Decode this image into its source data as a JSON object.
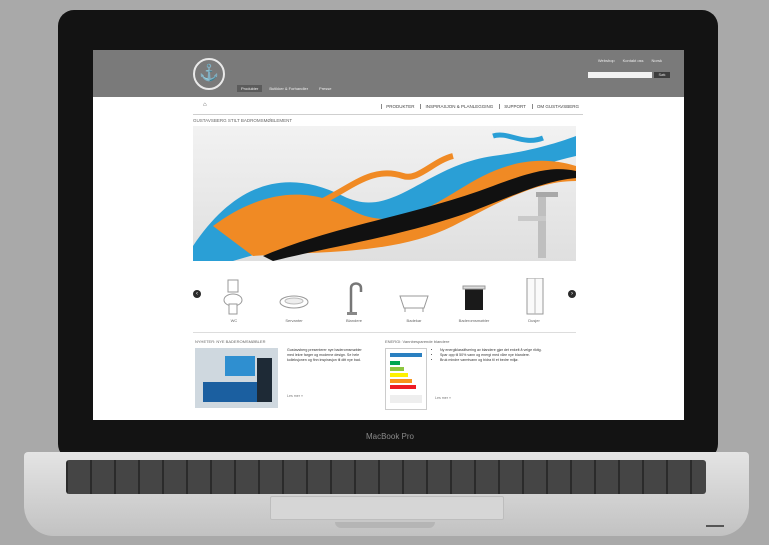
{
  "laptop": {
    "brand": "MacBook Pro"
  },
  "site": {
    "logo": "⚓",
    "top_links": [
      "Webshop",
      "Kontakt oss",
      "Norsk"
    ],
    "search_placeholder": "",
    "search_button": "Søk",
    "header_tabs": [
      {
        "label": "Produkter",
        "active": true
      },
      {
        "label": "Butikker & Forhandler",
        "active": false
      },
      {
        "label": "Presse",
        "active": false
      }
    ],
    "nav_home_icon": "home-icon",
    "nav_items": [
      "PRODUKTER",
      "INSPIRASJON & PLANLEGGING",
      "SUPPORT",
      "OM GUSTAVSBERG"
    ],
    "hero_heading": "GUSTAVSBERG STILT BADROMSMØBLEMENT",
    "products": [
      {
        "label": "WC",
        "icon": "toilet-icon"
      },
      {
        "label": "Servanter",
        "icon": "washbasin-icon"
      },
      {
        "label": "Blandere",
        "icon": "faucet-icon"
      },
      {
        "label": "Badekar",
        "icon": "bathtub-icon"
      },
      {
        "label": "Baderomsmøbler",
        "icon": "vanity-cabinet-icon"
      },
      {
        "label": "Dusjer",
        "icon": "shower-icon"
      }
    ],
    "news": {
      "heading": "NYHETER: NYE BADEROMSMØBLER",
      "text": "Gustavsberg presenterer nye baderomsmøbler med lekre farger og moderne design. Se hele kolleksjonen og finn inspirasjon til ditt nye bad.",
      "more": "Les mer »"
    },
    "energy": {
      "heading": "ENERGI: Vannbesparende blandere",
      "items": [
        "Ny energiklassifisering av blandere gjør det enkelt å velge riktig.",
        "Spar opp til 50% vann og energi med våre nye blandere.",
        "Bruk mindre varmtvann og bidra til et bedre miljø."
      ],
      "more": "Les mer »"
    }
  }
}
